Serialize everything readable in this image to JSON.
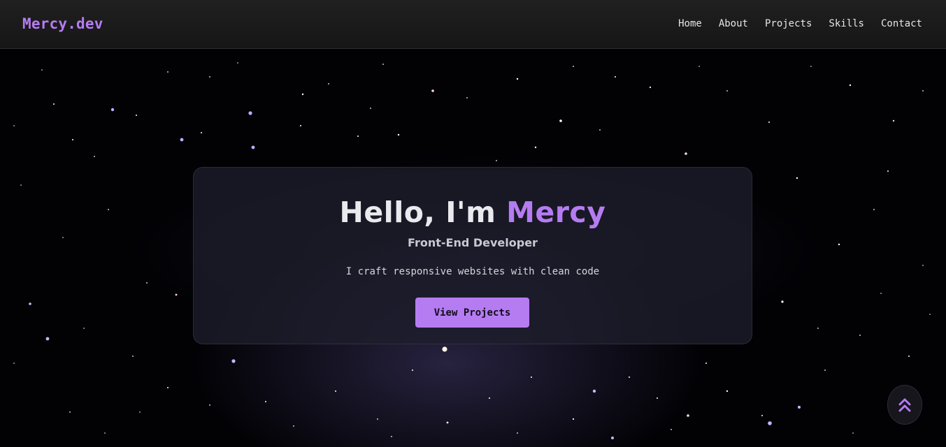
{
  "navbar": {
    "logo": "Mercy.dev",
    "links": [
      "Home",
      "About",
      "Projects",
      "Skills",
      "Contact"
    ]
  },
  "hero": {
    "greeting": "Hello, I'm",
    "name": "Mercy",
    "subtitle": "Front-End Developer",
    "tagline": "I craft responsive websites with clean code",
    "cta_label": "View Projects"
  },
  "back_to_top": {
    "icon": "double-chevron-up-icon"
  },
  "colors": {
    "accent": "#b57cf2",
    "navbar_bg": "#1b1b1b",
    "page_bg": "#020205",
    "card_bg": "#1e1e2c"
  }
}
